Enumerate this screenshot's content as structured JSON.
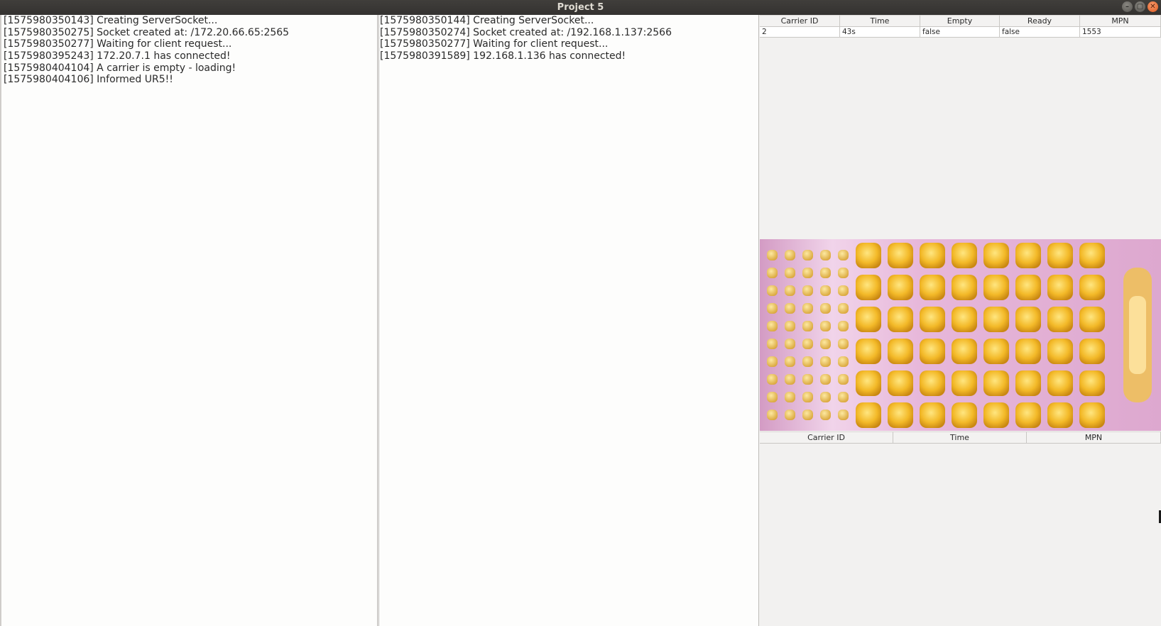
{
  "window": {
    "title": "Project 5",
    "controls": {
      "minimize": "–",
      "maximize": "▢",
      "close": "✕"
    }
  },
  "log_left": {
    "lines": [
      "[1575980350143] Creating ServerSocket...",
      "[1575980350275] Socket created at: /172.20.66.65:2565",
      "[1575980350277] Waiting for client request...",
      "[1575980395243] 172.20.7.1 has connected!",
      "[1575980404104] A carrier is empty - loading!",
      "[1575980404106] Informed UR5!!"
    ]
  },
  "log_right": {
    "lines": [
      "[1575980350144] Creating ServerSocket...",
      "[1575980350274] Socket created at: /192.168.1.137:2566",
      "[1575980350277] Waiting for client request...",
      "[1575980391589] 192.168.1.136 has connected!"
    ]
  },
  "carrier_table": {
    "headers": [
      "Carrier ID",
      "Time",
      "Empty",
      "Ready",
      "MPN"
    ],
    "rows": [
      [
        "2",
        "43s",
        "false",
        "false",
        "1553"
      ]
    ]
  },
  "camera_feed": {
    "description_icon": "pill-blister-camera-feed",
    "colors": {
      "background": "#e8b8d8",
      "pill": "#f3b928",
      "pill_highlight": "#ffe680"
    }
  },
  "history_table": {
    "headers": [
      "Carrier ID",
      "Time",
      "MPN"
    ],
    "rows": []
  }
}
